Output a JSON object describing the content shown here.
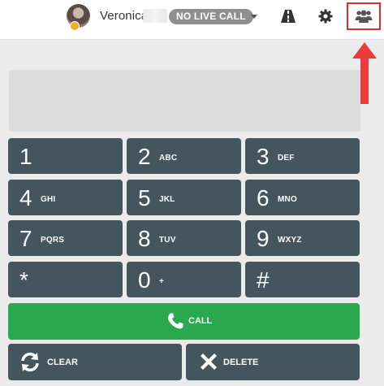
{
  "header": {
    "username": "Veronica",
    "call_status": "NO LIVE CALL",
    "icons": [
      "road-icon",
      "gear-icon",
      "users-icon"
    ]
  },
  "keypad": {
    "keys": [
      {
        "digit": "1",
        "letters": ""
      },
      {
        "digit": "2",
        "letters": "ABC"
      },
      {
        "digit": "3",
        "letters": "DEF"
      },
      {
        "digit": "4",
        "letters": "GHI"
      },
      {
        "digit": "5",
        "letters": "JKL"
      },
      {
        "digit": "6",
        "letters": "MNO"
      },
      {
        "digit": "7",
        "letters": "PQRS"
      },
      {
        "digit": "8",
        "letters": "TUV"
      },
      {
        "digit": "9",
        "letters": "WXYZ"
      },
      {
        "digit": "*",
        "letters": ""
      },
      {
        "digit": "0",
        "letters": "+"
      },
      {
        "digit": "#",
        "letters": ""
      }
    ]
  },
  "actions": {
    "call_label": "CALL",
    "clear_label": "CLEAR",
    "delete_label": "DELETE"
  },
  "colors": {
    "key_bg": "#45555e",
    "call_bg": "#29a84e",
    "badge_bg": "#8f8f8f",
    "highlight": "#e02b2b"
  }
}
